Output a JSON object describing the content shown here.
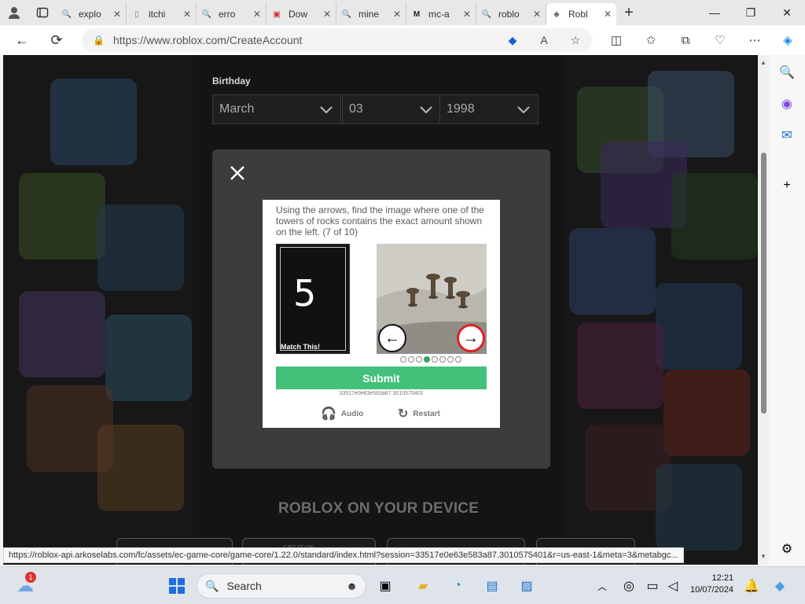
{
  "browser": {
    "tabs": [
      {
        "label": "explo",
        "icon": "search-icon"
      },
      {
        "label": "itchi",
        "icon": "document-icon"
      },
      {
        "label": "erro",
        "icon": "search-icon"
      },
      {
        "label": "Dow",
        "icon": "download-icon"
      },
      {
        "label": "mine",
        "icon": "search-icon"
      },
      {
        "label": "mc-a",
        "icon": "m-icon"
      },
      {
        "label": "roblo",
        "icon": "search-icon"
      },
      {
        "label": "Robl",
        "icon": "roblox-icon",
        "active": true
      }
    ],
    "url": "https://www.roblox.com/CreateAccount",
    "status_url": "https://roblox-api.arkoselabs.com/fc/assets/ec-game-core/game-core/1.22.0/standard/index.html?session=33517e0e63e583a87.3010575401&r=us-east-1&meta=3&metabgc..."
  },
  "page": {
    "birthday_label": "Birthday",
    "month": "March",
    "day": "03",
    "year": "1998",
    "device_heading": "ROBLOX ON YOUR DEVICE",
    "stub_text": "GET IT ON"
  },
  "captcha": {
    "instructions": "Using the arrows, find the image where one of the towers of rocks contains the exact amount shown on the left. (7 of 10)",
    "match_digit": "5",
    "match_label": "Match This!",
    "pagination_total": 8,
    "pagination_active": 4,
    "submit_label": "Submit",
    "session_id": "33517e0e63e583a87.3010575401",
    "audio_label": "Audio",
    "restart_label": "Restart"
  },
  "taskbar": {
    "search_placeholder": "Search",
    "weather_badge": "1",
    "time": "12:21",
    "date": "10/07/2024"
  },
  "colors": {
    "submit": "#43c07a",
    "dot_active": "#3aa35c",
    "arrow_highlight": "#dd2222"
  }
}
